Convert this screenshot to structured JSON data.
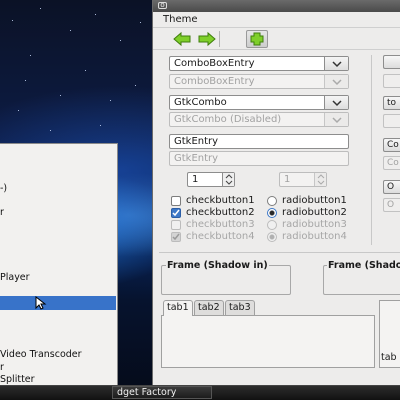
{
  "menu": {
    "items": [
      {
        "label": "-)",
        "highlight": false
      },
      {
        "label": "r",
        "highlight": false
      },
      {
        "label": "Player",
        "highlight": false
      },
      {
        "label": "",
        "highlight": true
      },
      {
        "label": "Video Transcoder",
        "highlight": false
      },
      {
        "label": "r",
        "highlight": false
      },
      {
        "label": "Splitter",
        "highlight": false
      }
    ]
  },
  "taskbar": {
    "task_label": "dget Factory"
  },
  "window": {
    "menubar": {
      "theme_label": "Theme"
    },
    "toolbar": {
      "back_icon": "arrow-left-icon",
      "forward_icon": "arrow-right-icon",
      "add_icon": "plus-icon"
    },
    "combos": {
      "comboboxentry": "ComboBoxEntry",
      "comboboxentry_disabled": "ComboBoxEntry",
      "gtkcombo": "GtkCombo",
      "gtkcombo_disabled": "GtkCombo (Disabled)"
    },
    "entries": {
      "gtkentry": "GtkEntry",
      "gtkentry_disabled": "GtkEntry"
    },
    "spins": {
      "enabled_value": "1",
      "disabled_value": "1"
    },
    "checks": {
      "checkbutton1": "checkbutton1",
      "checkbutton2": "checkbutton2",
      "checkbutton3": "checkbutton3",
      "checkbutton4": "checkbutton4"
    },
    "radios": {
      "radiobutton1": "radiobutton1",
      "radiobutton2": "radiobutton2",
      "radiobutton3": "radiobutton3",
      "radiobutton4": "radiobutton4"
    },
    "right_buttons": [
      "",
      "",
      "to",
      "",
      "Co",
      "Co",
      "O",
      "O"
    ],
    "frames": {
      "shadow_in": "Frame (Shadow in)",
      "shadow_clipped": "Frame (Shado"
    },
    "notebook": {
      "tabs": [
        "tab1",
        "tab2",
        "tab3"
      ],
      "second_tab": "tab"
    }
  }
}
